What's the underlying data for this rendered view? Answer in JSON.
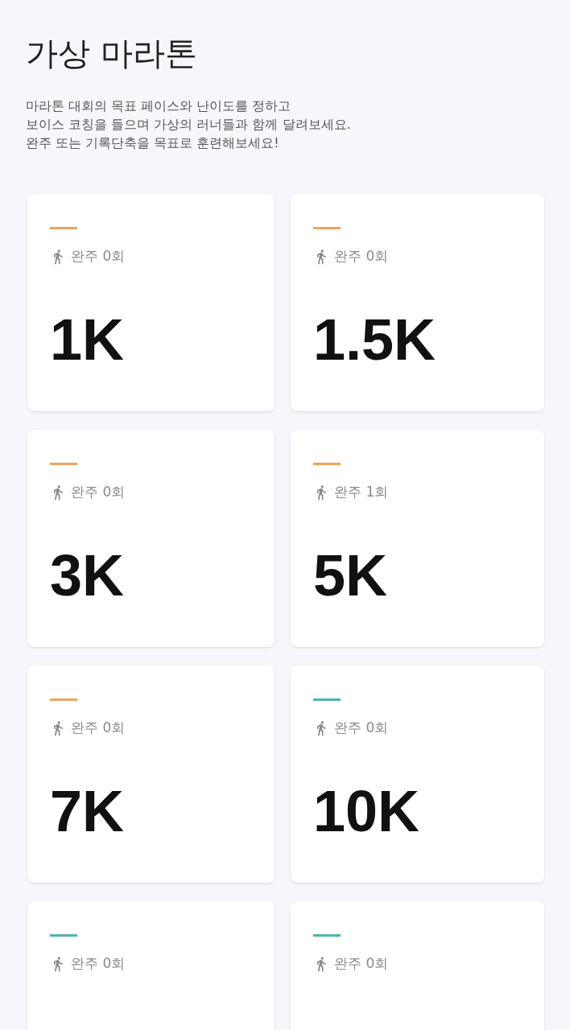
{
  "title": "가상 마라톤",
  "description": [
    "마라톤 대회의 목표 페이스와 난이도를 정하고",
    "보이스 코칭을 들으며 가상의 러너들과 함께 달려보세요.",
    "완주 또는 기록단축을 목표로 훈련해보세요!"
  ],
  "courses": [
    {
      "color": "#f0a35e",
      "completions": "완주 0회",
      "distance": "1K"
    },
    {
      "color": "#f0a35e",
      "completions": "완주 0회",
      "distance": "1.5K"
    },
    {
      "color": "#f0a35e",
      "completions": "완주 0회",
      "distance": "3K"
    },
    {
      "color": "#f0a35e",
      "completions": "완주 1회",
      "distance": "5K"
    },
    {
      "color": "#f0a35e",
      "completions": "완주 0회",
      "distance": "7K"
    },
    {
      "color": "#4db6ac",
      "completions": "완주 0회",
      "distance": "10K"
    },
    {
      "color": "#4db6ac",
      "completions": "완주 0회"
    },
    {
      "color": "#4db6ac",
      "completions": "완주 0회"
    }
  ]
}
